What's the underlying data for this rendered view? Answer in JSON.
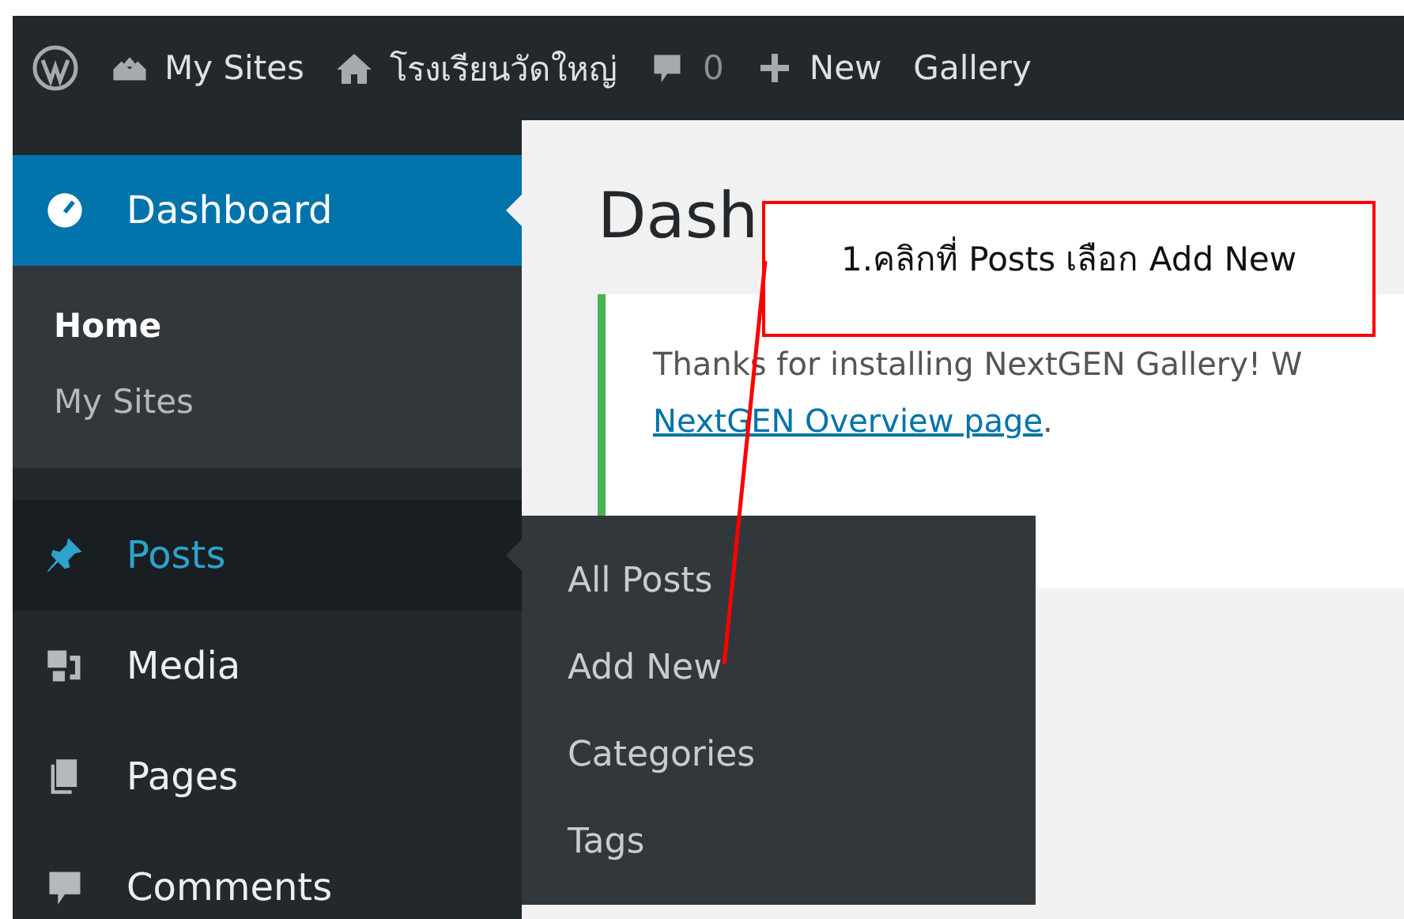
{
  "admin_bar": {
    "my_sites": "My Sites",
    "site_name": "โรงเรียนวัดใหญ่",
    "comments_count": "0",
    "new": "New",
    "gallery": "Gallery"
  },
  "sidebar": {
    "items": [
      {
        "label": "Dashboard",
        "selected": true,
        "hovered": false,
        "children": [
          {
            "label": "Home",
            "selected": true
          },
          {
            "label": "My Sites",
            "selected": false
          }
        ]
      },
      {
        "label": "Posts",
        "selected": false,
        "hovered": true
      },
      {
        "label": "Media",
        "selected": false,
        "hovered": false
      },
      {
        "label": "Pages",
        "selected": false,
        "hovered": false
      },
      {
        "label": "Comments",
        "selected": false,
        "hovered": false
      }
    ]
  },
  "flyout": {
    "items": [
      "All Posts",
      "Add New",
      "Categories",
      "Tags"
    ]
  },
  "content": {
    "heading": "Dash",
    "notice": {
      "text": "Thanks for installing NextGEN Gallery! W",
      "link": "NextGEN Overview page",
      "after_link": "."
    }
  },
  "annotation": {
    "text": "1.คลิกที่ Posts เลือก Add New"
  }
}
